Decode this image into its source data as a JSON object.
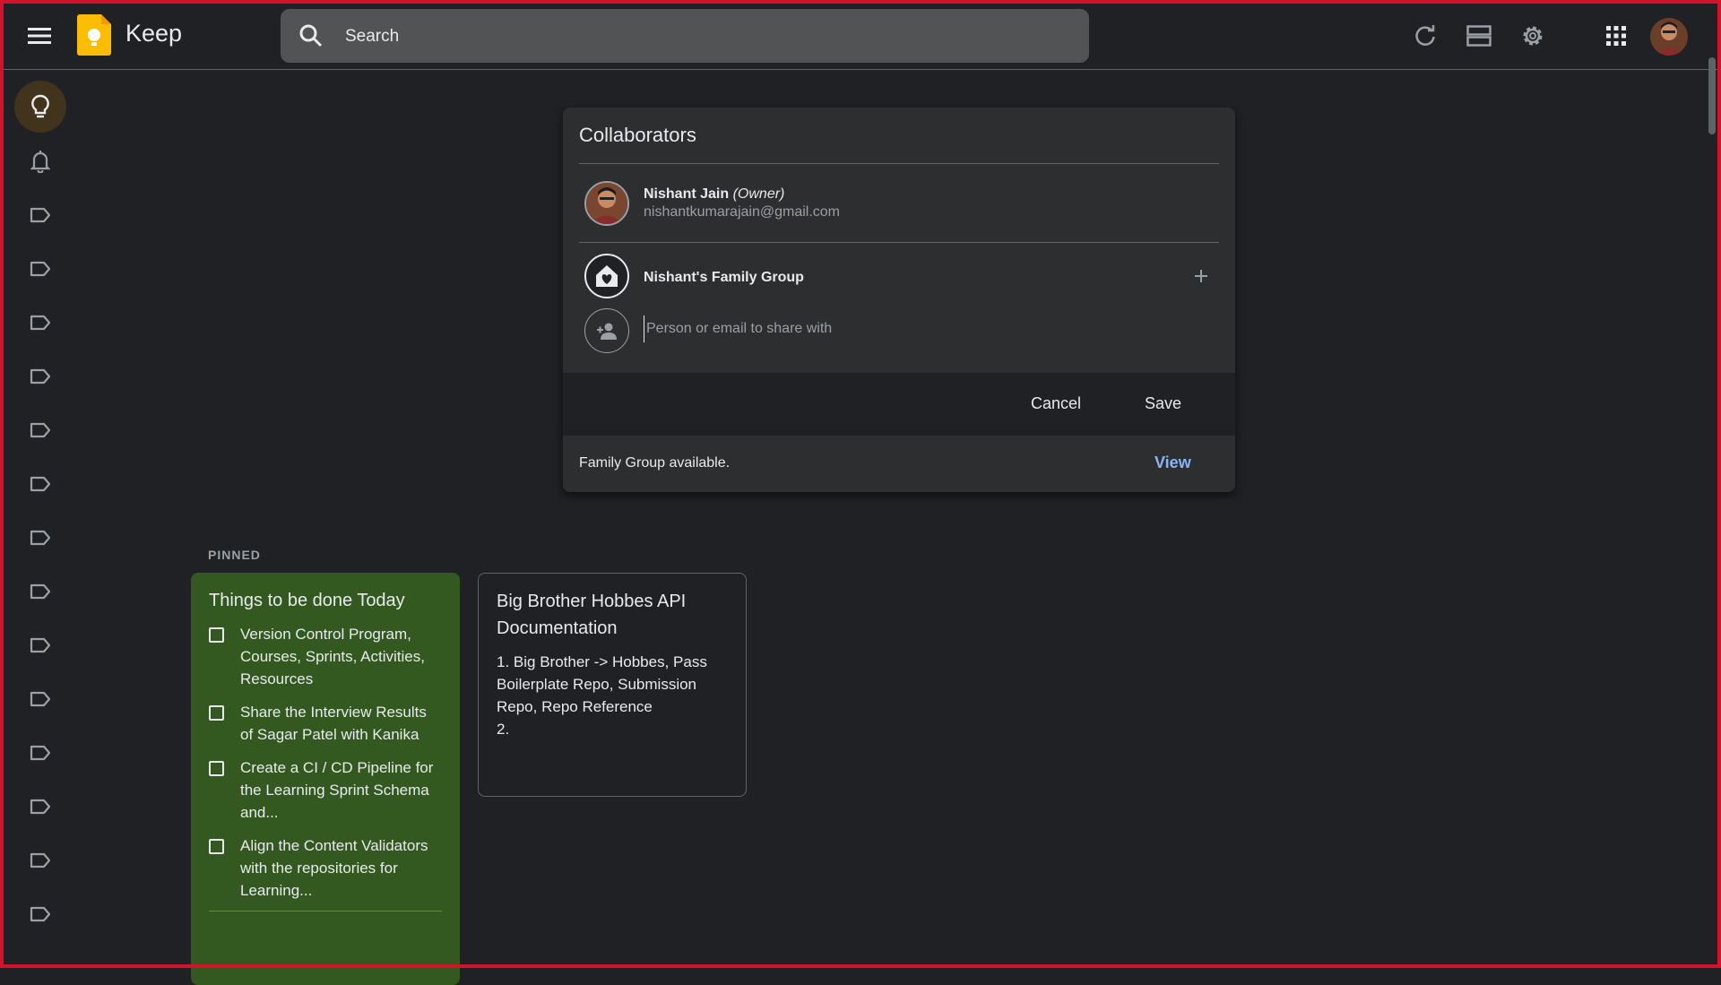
{
  "app": {
    "title": "Keep"
  },
  "search": {
    "placeholder": "Search"
  },
  "pinned": {
    "label": "PINNED"
  },
  "notes": [
    {
      "title": "Things to be done Today",
      "color": "#345920",
      "items": [
        "Version Control Program, Courses, Sprints,  Activities, Resources",
        "Share the Interview Results of Sagar Patel with Kanika",
        "Create a CI / CD Pipeline for the Learning Sprint Schema and...",
        "Align the Content Validators with the repositories for Learning..."
      ]
    },
    {
      "title": "Big Brother Hobbes API Documentation",
      "body": "1. Big Brother -> Hobbes, Pass Boilerplate Repo, Submission Repo, Repo Reference\n2."
    }
  ],
  "dialog": {
    "title": "Collaborators",
    "owner": {
      "name": "Nishant Jain",
      "role": "(Owner)",
      "email": "nishantkumarajain@gmail.com"
    },
    "group": {
      "name": "Nishant's Family Group"
    },
    "share_placeholder": "Person or email to share with",
    "cancel_label": "Cancel",
    "save_label": "Save",
    "footer_text": "Family Group available.",
    "view_label": "View"
  },
  "colors": {
    "accent": "#fbbc04",
    "link": "#8ab4f8",
    "background": "#202124"
  },
  "icons": {
    "menu": "hamburger-menu-icon",
    "search": "search-icon",
    "refresh": "refresh-icon",
    "list_view": "list-view-icon",
    "settings": "gear-icon",
    "apps": "apps-grid-icon",
    "notes": "lightbulb-icon",
    "reminders": "bell-icon",
    "label": "label-icon"
  }
}
